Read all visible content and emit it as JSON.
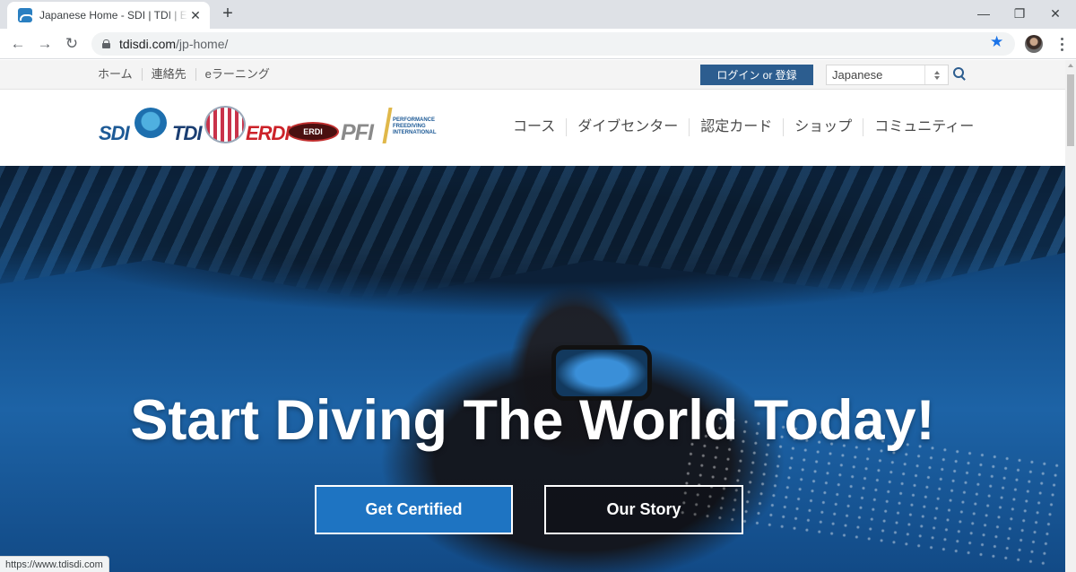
{
  "browser": {
    "tab_title": "Japanese Home - SDI | TDI | ERDI",
    "url_domain": "tdisdi.com",
    "url_path": "/jp-home/",
    "status_url": "https://www.tdisdi.com"
  },
  "utility_bar": {
    "links": [
      "ホーム",
      "連絡先",
      "eラーニング"
    ],
    "login_label": "ログイン or 登録",
    "language": "Japanese"
  },
  "logos": {
    "sdi": "SDI",
    "tdi": "TDI",
    "erdi": "ERDI",
    "erdi_badge": "ERDI",
    "pfi": "PFI",
    "pfi_sub": "PERFORMANCE FREEDIVING INTERNATIONAL"
  },
  "main_nav": {
    "items": [
      "コース",
      "ダイブセンター",
      "認定カード",
      "ショップ",
      "コミュニティー"
    ]
  },
  "hero": {
    "title": "Start Diving The World Today!",
    "primary_cta": "Get Certified",
    "secondary_cta": "Our Story"
  },
  "colors": {
    "login_bg": "#2c5d8f",
    "cta_primary": "#1e74c2",
    "bookmark_star": "#1a73e8"
  },
  "icons": [
    "favicon-icon",
    "close-icon",
    "plus-icon",
    "minimize-icon",
    "restore-icon",
    "window-close-icon",
    "back-icon",
    "forward-icon",
    "reload-icon",
    "lock-icon",
    "star-icon",
    "profile-avatar",
    "kebab-menu-icon",
    "search-icon"
  ]
}
